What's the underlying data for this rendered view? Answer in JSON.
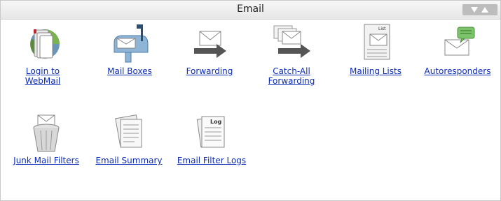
{
  "header": {
    "title": "Email",
    "toggle_icon": "collapse-arrows-icon"
  },
  "colors": {
    "link": "#0d2cb8",
    "header_bg": "#ececec",
    "button": "#bdbdbd"
  },
  "items": [
    {
      "line1": "Login to",
      "line2": "WebMail",
      "icon": "webmail-icon"
    },
    {
      "line1": "Mail Boxes",
      "line2": "",
      "icon": "mailbox-icon"
    },
    {
      "line1": "Forwarding",
      "line2": "",
      "icon": "forwarding-icon"
    },
    {
      "line1": "Catch-All",
      "line2": "Forwarding",
      "icon": "catch-all-forwarding-icon"
    },
    {
      "line1": "Mailing Lists",
      "line2": "",
      "icon": "mailing-list-icon"
    },
    {
      "line1": "Autoresponders",
      "line2": "",
      "icon": "autoresponder-icon"
    },
    {
      "line1": "Junk Mail Filters",
      "line2": "",
      "icon": "trash-filter-icon"
    },
    {
      "line1": "Email Summary",
      "line2": "",
      "icon": "email-summary-icon"
    },
    {
      "line1": "Email Filter Logs",
      "line2": "",
      "icon": "filter-log-icon"
    }
  ]
}
